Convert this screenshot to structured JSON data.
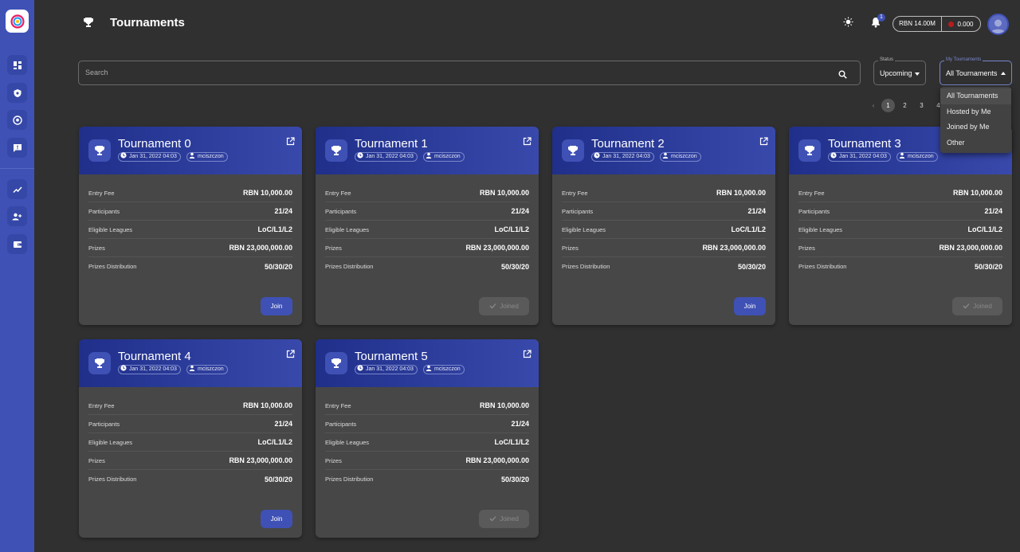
{
  "header": {
    "title": "Tournaments",
    "notification_count": "1"
  },
  "wallet": {
    "rbn": "RBN 14.00M",
    "balance": "0.000"
  },
  "filters": {
    "search_placeholder": "Search",
    "status_label": "Status",
    "status_value": "Upcoming",
    "mine_label": "My Tournaments",
    "mine_value": "All Tournaments",
    "mine_options": [
      "All Tournaments",
      "Hosted by Me",
      "Joined by Me",
      "Other"
    ]
  },
  "pagination": {
    "prev": "‹",
    "pages": [
      "1",
      "2",
      "3",
      "4"
    ],
    "current": "1"
  },
  "row_labels": {
    "entry_fee": "Entry Fee",
    "participants": "Participants",
    "leagues": "Eligible Leagues",
    "prizes": "Prizes",
    "distribution": "Prizes Distribution"
  },
  "buttons": {
    "join": "Join",
    "joined": "Joined"
  },
  "tournaments": [
    {
      "name": "Tournament 0",
      "date": "Jan 31, 2022 04:03",
      "host": "mciszczon",
      "entry_fee": "RBN 10,000.00",
      "participants": "21/24",
      "leagues": "LoC/L1/L2",
      "prizes": "RBN 23,000,000.00",
      "distribution": "50/30/20",
      "joined": false
    },
    {
      "name": "Tournament 1",
      "date": "Jan 31, 2022 04:03",
      "host": "mciszczon",
      "entry_fee": "RBN 10,000.00",
      "participants": "21/24",
      "leagues": "LoC/L1/L2",
      "prizes": "RBN 23,000,000.00",
      "distribution": "50/30/20",
      "joined": true
    },
    {
      "name": "Tournament 2",
      "date": "Jan 31, 2022 04:03",
      "host": "mciszczon",
      "entry_fee": "RBN 10,000.00",
      "participants": "21/24",
      "leagues": "LoC/L1/L2",
      "prizes": "RBN 23,000,000.00",
      "distribution": "50/30/20",
      "joined": false
    },
    {
      "name": "Tournament 3",
      "date": "Jan 31, 2022 04:03",
      "host": "mciszczon",
      "entry_fee": "RBN 10,000.00",
      "participants": "21/24",
      "leagues": "LoC/L1/L2",
      "prizes": "RBN 23,000,000.00",
      "distribution": "50/30/20",
      "joined": true
    },
    {
      "name": "Tournament 4",
      "date": "Jan 31, 2022 04:03",
      "host": "mciszczon",
      "entry_fee": "RBN 10,000.00",
      "participants": "21/24",
      "leagues": "LoC/L1/L2",
      "prizes": "RBN 23,000,000.00",
      "distribution": "50/30/20",
      "joined": false
    },
    {
      "name": "Tournament 5",
      "date": "Jan 31, 2022 04:03",
      "host": "mciszczon",
      "entry_fee": "RBN 10,000.00",
      "participants": "21/24",
      "leagues": "LoC/L1/L2",
      "prizes": "RBN 23,000,000.00",
      "distribution": "50/30/20",
      "joined": true
    }
  ],
  "sidebar": {
    "items": [
      "dashboard-icon",
      "shield-icon",
      "soccer-ball-icon",
      "feedback-icon",
      "trending-icon",
      "group-add-icon",
      "wallet-icon"
    ]
  },
  "colors": {
    "accent": "#3f51b5",
    "background": "#303030",
    "card": "#474747"
  }
}
